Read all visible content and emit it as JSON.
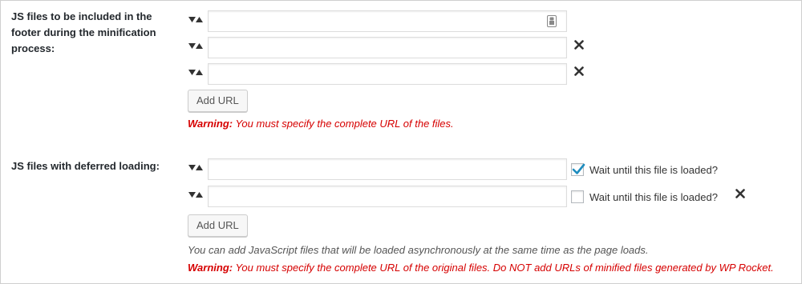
{
  "footer_js": {
    "label": "JS files to be included in the footer during the minification process:",
    "rows": [
      {
        "value": "",
        "removable": false
      },
      {
        "value": "",
        "removable": true
      },
      {
        "value": "",
        "removable": true
      }
    ],
    "add_url_label": "Add URL",
    "warning_prefix": "Warning:",
    "warning_text": " You must specify the complete URL of the files."
  },
  "deferred_js": {
    "label": "JS files with deferred loading:",
    "rows": [
      {
        "value": "",
        "wait_label": "Wait until this file is loaded?",
        "wait_checked": true,
        "removable": false
      },
      {
        "value": "",
        "wait_label": "Wait until this file is loaded?",
        "wait_checked": false,
        "removable": true
      }
    ],
    "add_url_label": "Add URL",
    "description": "You can add JavaScript files that will be loaded asynchronously at the same time as the page loads.",
    "warning_prefix": "Warning:",
    "warning_text": " You must specify the complete URL of the original files. Do NOT add URLs of minified files generated by WP Rocket."
  },
  "icons": {
    "drag": "sort-handle-icon",
    "remove": "close-x-icon",
    "autofill": "password-manager-icon",
    "check": "checkmark-icon"
  },
  "colors": {
    "warning": "#d60000",
    "check": "#1e8cbe",
    "remove": "#333333"
  }
}
